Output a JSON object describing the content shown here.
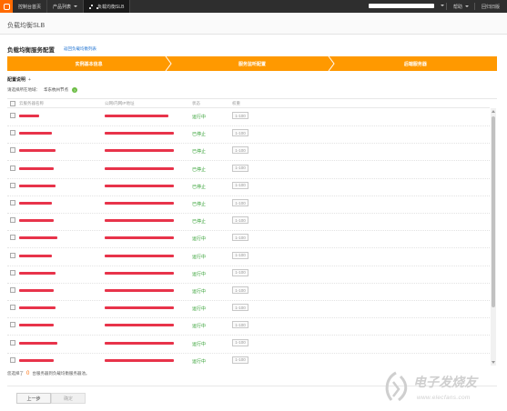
{
  "topbar": {
    "logo_icon": "aliyun-logo-icon",
    "console_home": "控制台首页",
    "products": "产品列表",
    "current_product": "负载均衡SLB",
    "help": "帮助",
    "logout": "回归旧版"
  },
  "page": {
    "title": "负载均衡SLB",
    "section_title": "负载均衡服务配置",
    "back_link": "返回负载均衡列表"
  },
  "steps": [
    "实例基本信息",
    "服务监听配置",
    "后端服务器"
  ],
  "config": {
    "label": "配置说明",
    "plus": "+",
    "region_label": "请选择所在地域：",
    "region_value": "华东杭州节点",
    "help_icon": "?"
  },
  "table": {
    "headers": {
      "name": "云服务器名称",
      "ip": "公网/内网IP地址",
      "status": "状态",
      "weight": "权重"
    },
    "rows": [
      {
        "status": "运行中",
        "weight_placeholder": "1-100"
      },
      {
        "status": "已停止",
        "weight_placeholder": "1-100"
      },
      {
        "status": "已停止",
        "weight_placeholder": "1-100"
      },
      {
        "status": "已停止",
        "weight_placeholder": "1-100"
      },
      {
        "status": "已停止",
        "weight_placeholder": "1-100"
      },
      {
        "status": "已停止",
        "weight_placeholder": "1-100"
      },
      {
        "status": "已停止",
        "weight_placeholder": "1-100"
      },
      {
        "status": "运行中",
        "weight_placeholder": "1-100"
      },
      {
        "status": "运行中",
        "weight_placeholder": "1-100"
      },
      {
        "status": "运行中",
        "weight_placeholder": "1-100"
      },
      {
        "status": "运行中",
        "weight_placeholder": "1-100"
      },
      {
        "status": "运行中",
        "weight_placeholder": "1-100"
      },
      {
        "status": "运行中",
        "weight_placeholder": "1-100"
      },
      {
        "status": "运行中",
        "weight_placeholder": "1-100"
      },
      {
        "status": "运行中",
        "weight_placeholder": "1-100"
      }
    ]
  },
  "selection": {
    "prefix": "您选择了",
    "count": "0",
    "suffix": "台服务器到负载均衡服务器池。"
  },
  "buttons": {
    "prev": "上一步",
    "confirm": "确定"
  },
  "watermark": {
    "title": "电子发烧友",
    "sub": "www.elecfans.com"
  },
  "colors": {
    "accent": "#ff9900",
    "topbar": "#2e2e2e",
    "status_running": "#2f9e2f",
    "redaction": "#e8334a"
  }
}
